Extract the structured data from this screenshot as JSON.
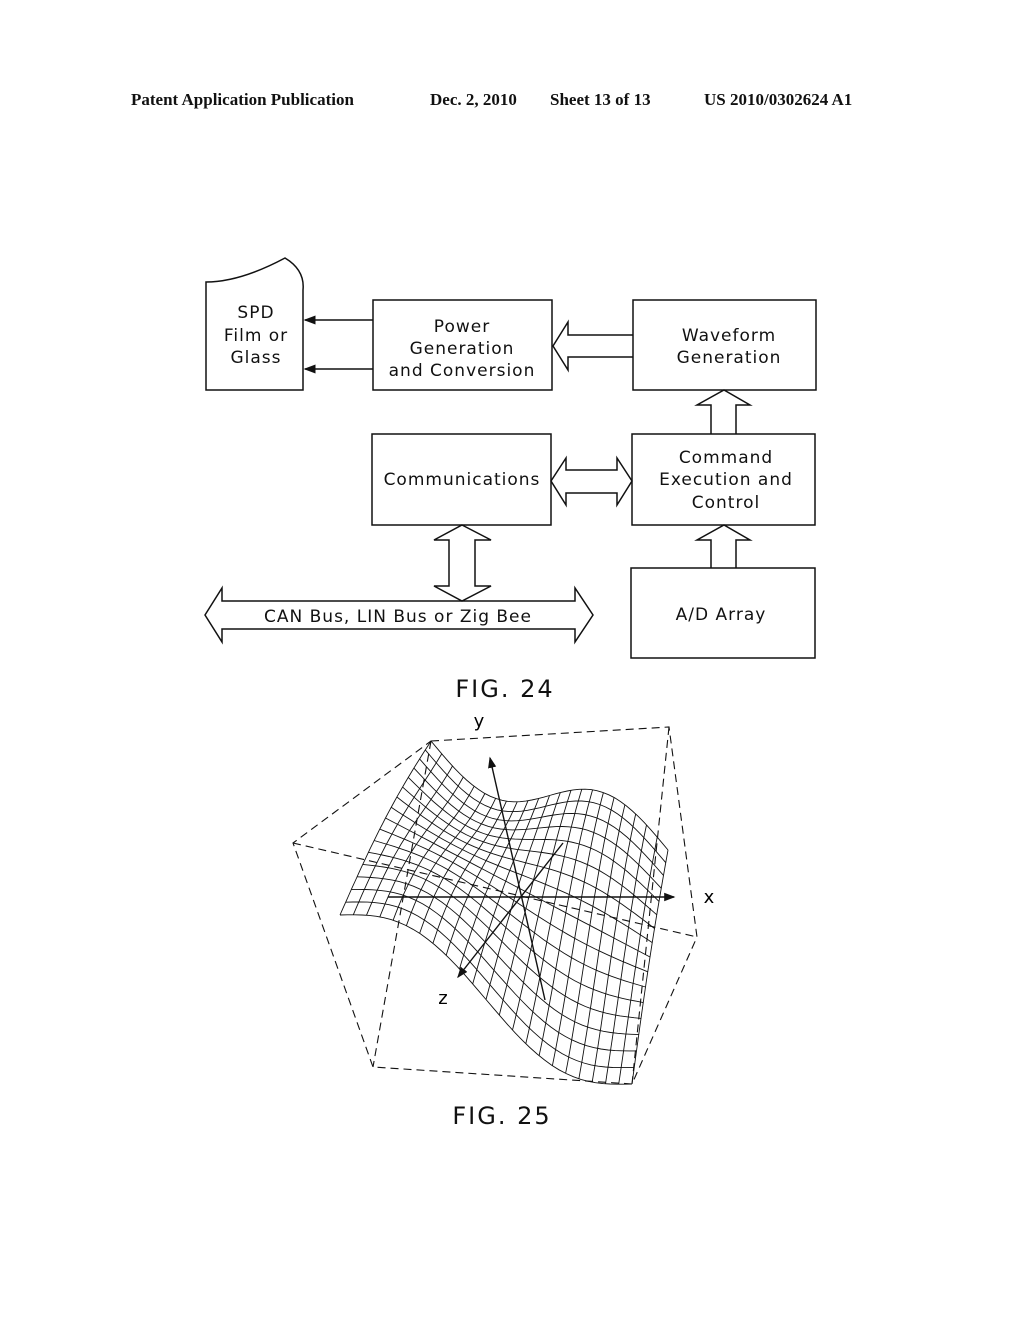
{
  "header": {
    "publication": "Patent Application Publication",
    "date": "Dec. 2, 2010",
    "sheet": "Sheet 13 of 13",
    "number": "US 2010/0302624 A1"
  },
  "fig24": {
    "label": "FIG. 24",
    "spd": [
      "SPD",
      "Film or",
      "Glass"
    ],
    "power": [
      "Power",
      "Generation",
      "and Conversion"
    ],
    "waveform": [
      "Waveform",
      "Generation"
    ],
    "communications": [
      "Communications"
    ],
    "command": [
      "Command",
      "Execution and",
      "Control"
    ],
    "ad": [
      "A/D Array"
    ],
    "bus": "CAN Bus, LIN Bus or Zig Bee"
  },
  "fig25": {
    "label": "FIG. 25",
    "axes": {
      "x": "x",
      "y": "y",
      "z": "z"
    }
  }
}
